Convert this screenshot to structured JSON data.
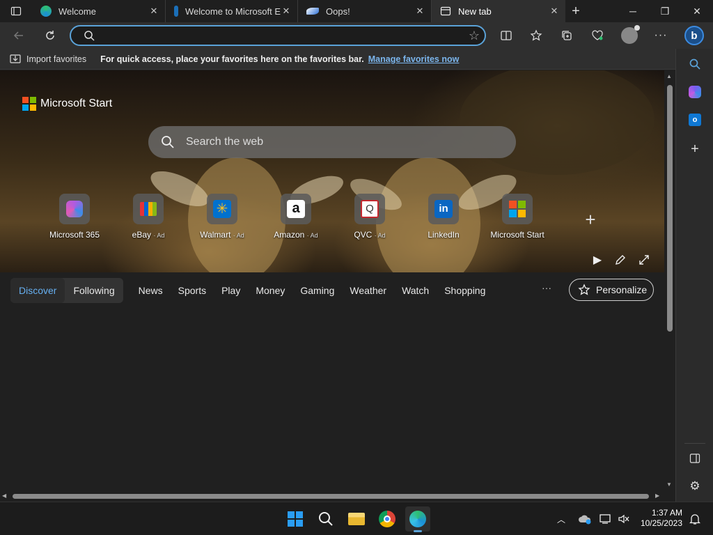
{
  "tabs": [
    {
      "title": "Welcome",
      "active": false,
      "favicon": "edge-icon"
    },
    {
      "title": "Welcome to Microsoft E",
      "active": false,
      "favicon": "microsoft-icon"
    },
    {
      "title": "Oops!",
      "active": false,
      "favicon": "swoosh-icon"
    },
    {
      "title": "New tab",
      "active": true,
      "favicon": "newtab-icon"
    }
  ],
  "address_bar": {
    "value": "",
    "placeholder": ""
  },
  "favorites_bar": {
    "import_label": "Import favorites",
    "message": "For quick access, place your favorites here on the favorites bar.",
    "manage_link": "Manage favorites now"
  },
  "brand": {
    "label": "Microsoft Start"
  },
  "web_search": {
    "placeholder": "Search the web"
  },
  "quick_links": [
    {
      "label": "Microsoft 365",
      "ad": ""
    },
    {
      "label": "eBay",
      "ad": "· Ad"
    },
    {
      "label": "Walmart",
      "ad": "· Ad"
    },
    {
      "label": "Amazon",
      "ad": "· Ad"
    },
    {
      "label": "QVC",
      "ad": "· Ad"
    },
    {
      "label": "LinkedIn",
      "ad": ""
    },
    {
      "label": "Microsoft Start",
      "ad": ""
    }
  ],
  "feed_nav": {
    "discover": "Discover",
    "following": "Following",
    "items": [
      "News",
      "Sports",
      "Play",
      "Money",
      "Gaming",
      "Weather",
      "Watch",
      "Shopping"
    ],
    "more": "···",
    "personalize": "Personalize"
  },
  "taskbar": {
    "time": "1:37 AM",
    "date": "10/25/2023"
  },
  "colors": {
    "accent": "#5aa2d8",
    "link": "#7bb5ec",
    "selected_tab": "#66aff0"
  }
}
